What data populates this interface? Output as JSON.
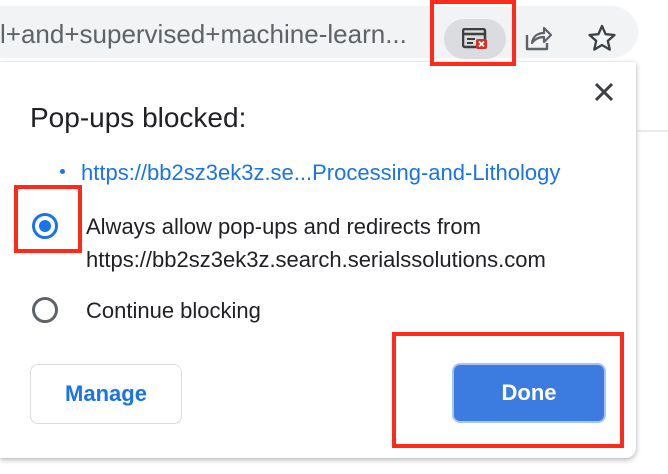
{
  "toolbar": {
    "omnibox_text": "l+and+supervised+machine-learn...",
    "popup_blocked_icon": "popup-blocked-icon",
    "share_icon": "share-icon",
    "bookmark_icon": "star-icon"
  },
  "popup": {
    "title": "Pop-ups blocked:",
    "blocked_link": "https://bb2sz3ek3z.se...Processing-and-Lithology",
    "option_allow": "Always allow pop-ups and redirects from https://bb2sz3ek3z.search.serialssolutions.com",
    "option_block": "Continue blocking",
    "selected_option": "allow",
    "manage_label": "Manage",
    "done_label": "Done",
    "close_icon": "close-icon"
  },
  "colors": {
    "accent": "#1a73e8",
    "done_button": "#3c7ce0",
    "annotation": "#ff2a1a"
  }
}
